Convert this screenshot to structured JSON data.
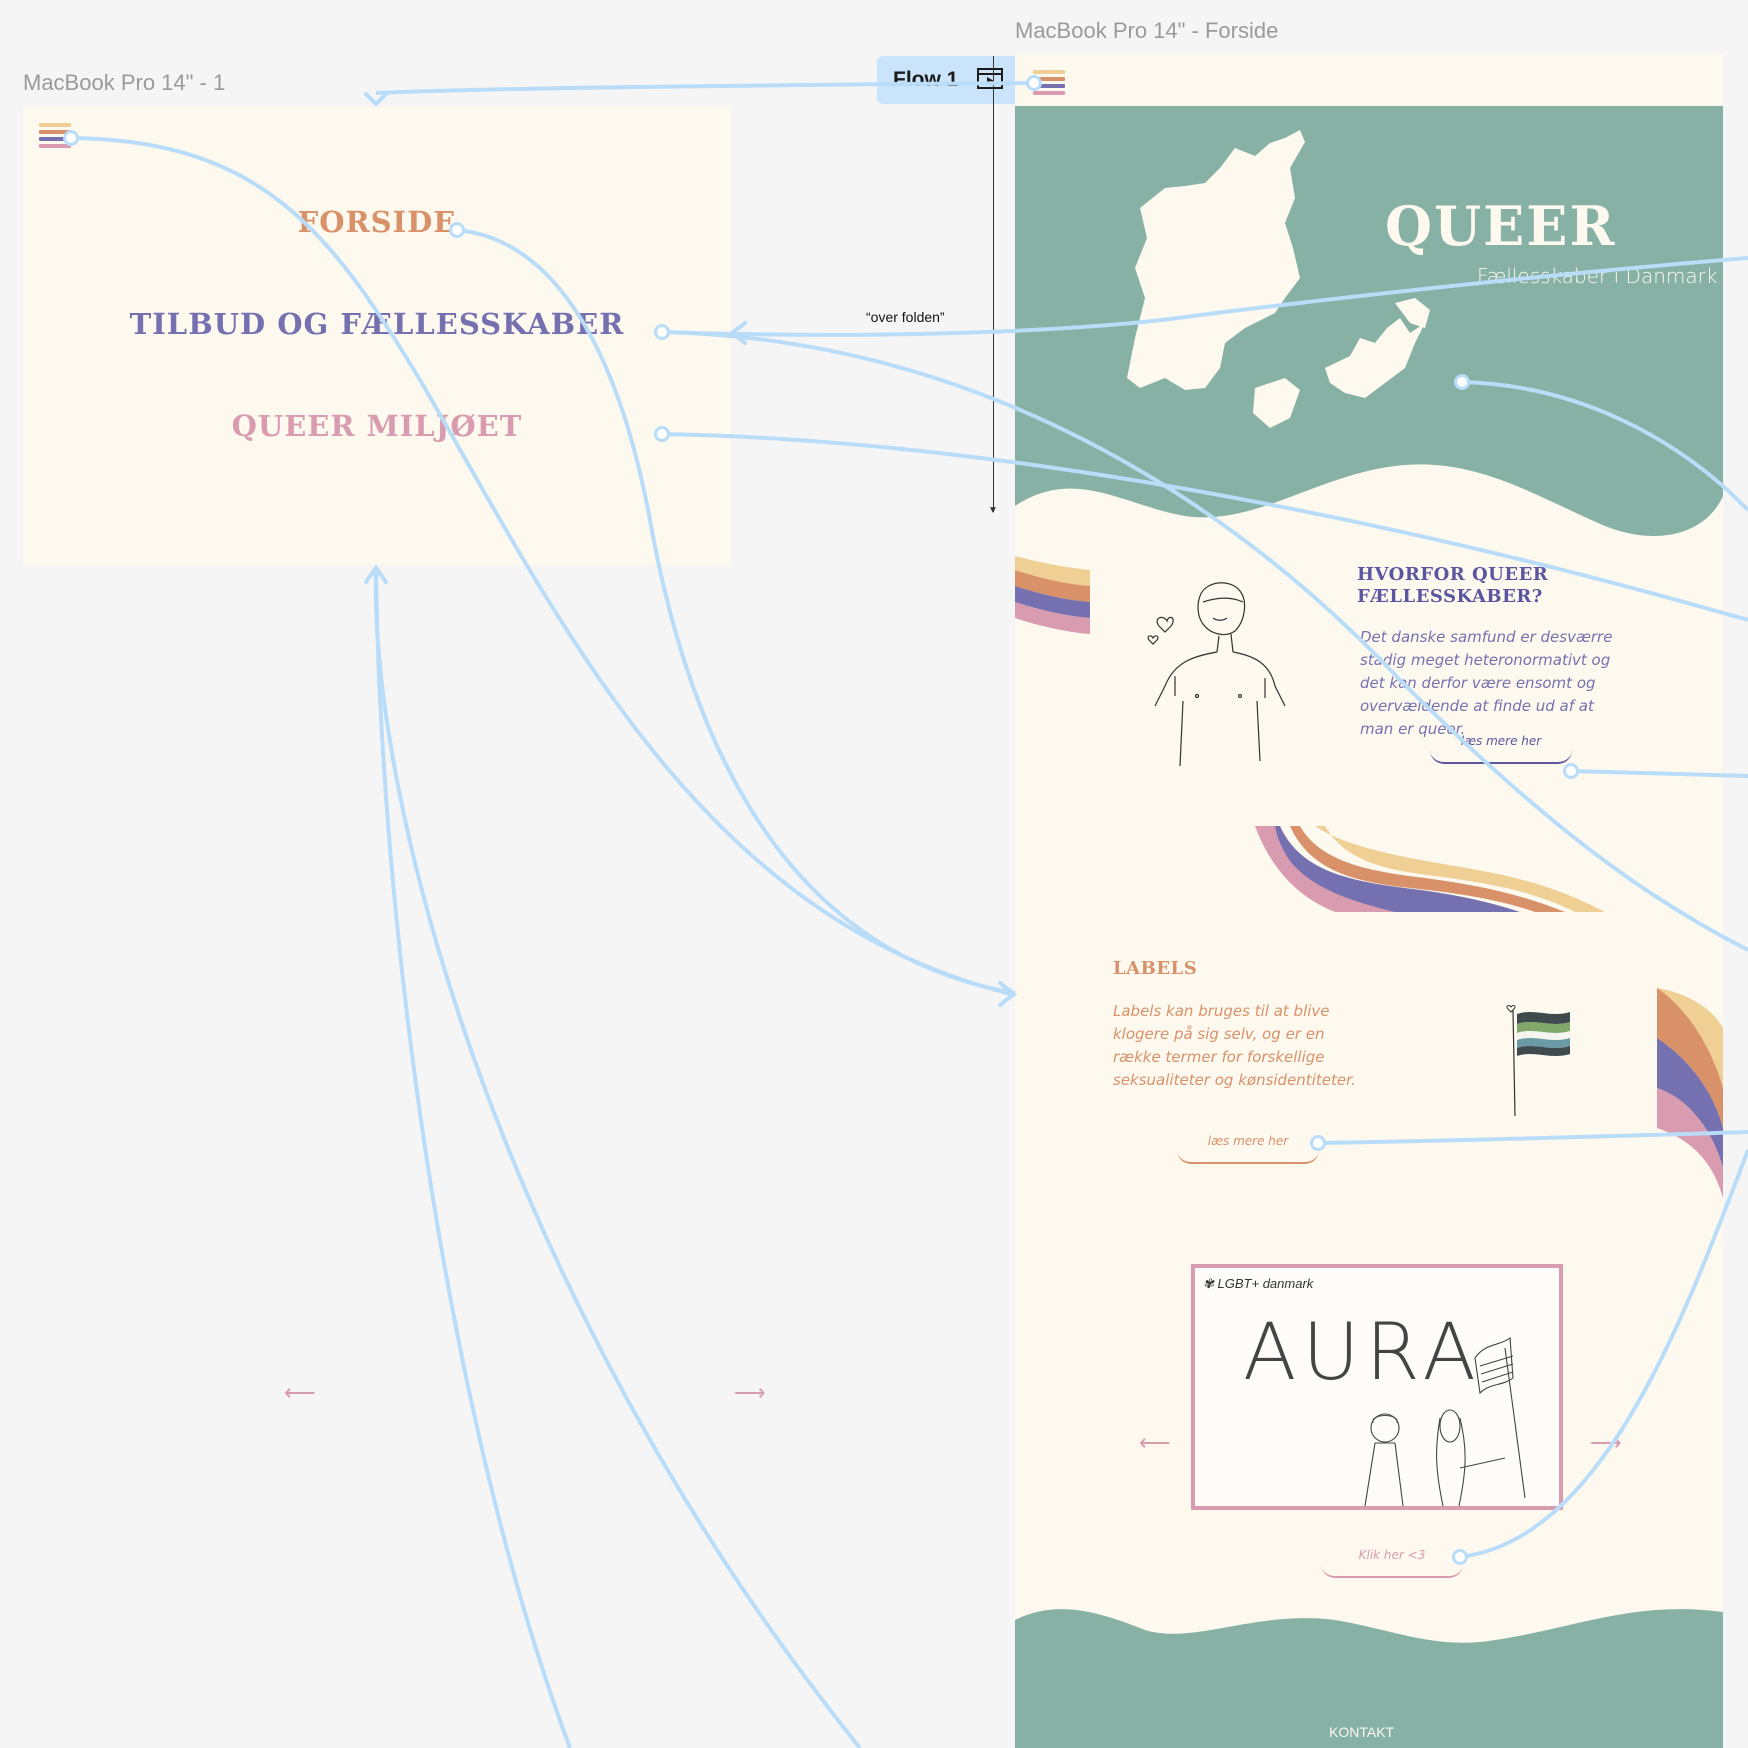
{
  "colors": {
    "canvas": "#f5f5f5",
    "frame_bg": "#fdf9ee",
    "teal": "#87b1a5",
    "orange": "#d9916a",
    "purple": "#7571b0",
    "pink": "#d99bb0",
    "yellow": "#efcf93",
    "flow_line": "#b9dcf8"
  },
  "frames": {
    "menu_label": "MacBook Pro 14\" - 1",
    "page_label": "MacBook Pro 14\" - Forside"
  },
  "flow": {
    "badge_label": "Flow 1",
    "badge_icon": "play-frame-icon",
    "fold_note": "“over folden”"
  },
  "menu": {
    "items": [
      {
        "label": "FORSIDE",
        "color": "#d9916a"
      },
      {
        "label": "TILBUD OG FÆLLESSKABER",
        "color": "#7571b0"
      },
      {
        "label": "QUEER MILJØET",
        "color": "#d99bb0"
      }
    ],
    "prev_arrow": "⟵",
    "next_arrow": "⟶"
  },
  "hero": {
    "title": "QUEER",
    "subtitle": "Fællesskaber i Danmark",
    "image": "denmark-map-silhouette"
  },
  "why_section": {
    "title_line1": "HVORFOR QUEER",
    "title_line2": "FÆLLESSKABER?",
    "text": "Det danske samfund er desværre stadig meget heteronormativt og det kan derfor være ensomt og overvældende at finde ud af at man er queer.",
    "button": "læs mere her",
    "image": "person-line-drawing"
  },
  "labels_section": {
    "title": "LABELS",
    "text": "Labels kan bruges til at blive klogere på sig selv, og er en række termer for forskellige seksualiteter og kønsidentiteter.",
    "button": "læs mere her",
    "image": "pride-flag-drawing"
  },
  "carousel": {
    "logo_text": "LGBT+ danmark",
    "poster_title": "AURA",
    "prev_arrow": "⟵",
    "next_arrow": "⟶",
    "button": "Klik her <3"
  },
  "footer": {
    "label": "KONTAKT"
  }
}
